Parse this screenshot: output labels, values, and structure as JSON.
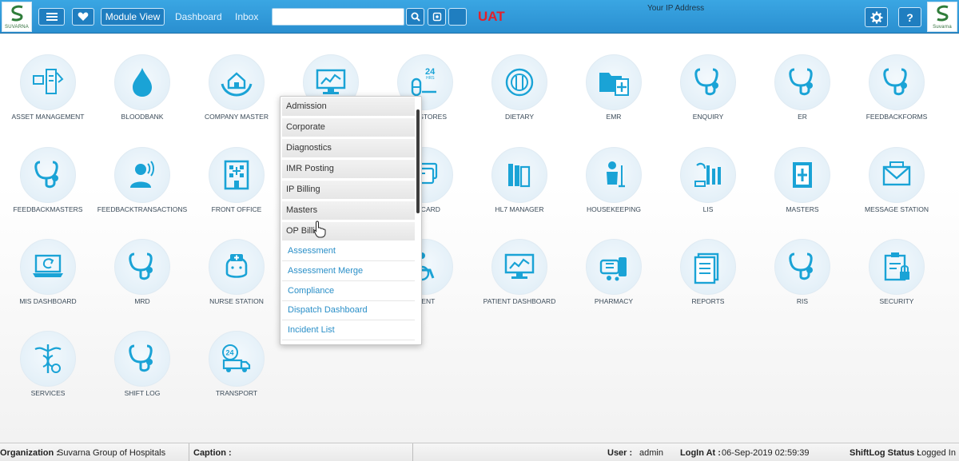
{
  "header": {
    "left_logo_text": "SUVARNA",
    "right_logo_text": "Suvarna",
    "menu_icon": "hamburger-icon",
    "favorites_icon": "heart-icon",
    "module_view_label": "Module View",
    "dashboard_link": "Dashboard",
    "inbox_link": "Inbox",
    "search": {
      "value": "",
      "placeholder": ""
    },
    "env_label": "UAT",
    "ip_label": "Your IP Address",
    "settings_icon": "gear-icon",
    "help_label": "?"
  },
  "modules": [
    {
      "label": "ASSET MANAGEMENT",
      "icon": "asset-icon"
    },
    {
      "label": "BLOODBANK",
      "icon": "blood-drop-icon"
    },
    {
      "label": "COMPANY MASTER",
      "icon": "home-hands-icon"
    },
    {
      "label": "",
      "icon": "monitor-chart-icon"
    },
    {
      "label": "ENT STORES",
      "icon": "pill-24hrs-icon",
      "badge": "24",
      "badge_sub": "HRS"
    },
    {
      "label": "DIETARY",
      "icon": "plate-cutlery-icon"
    },
    {
      "label": "EMR",
      "icon": "folder-plus-icon"
    },
    {
      "label": "ENQUIRY",
      "icon": "stethoscope-icon"
    },
    {
      "label": "ER",
      "icon": "stethoscope-icon"
    },
    {
      "label": "FEEDBACKFORMS",
      "icon": "stethoscope-icon"
    },
    {
      "label": "FEEDBACKMASTERS",
      "icon": "stethoscope-icon"
    },
    {
      "label": "FEEDBACKTRANSACTIONS",
      "icon": "speaking-person-icon"
    },
    {
      "label": "FRONT OFFICE",
      "icon": "hospital-building-icon"
    },
    {
      "label": "",
      "icon": "blank-icon"
    },
    {
      "label": "TH CARD",
      "icon": "cards-icon"
    },
    {
      "label": "HL7 MANAGER",
      "icon": "books-icon"
    },
    {
      "label": "HOUSEKEEPING",
      "icon": "housekeeper-icon"
    },
    {
      "label": "LIS",
      "icon": "lab-icon"
    },
    {
      "label": "MASTERS",
      "icon": "book-plus-icon"
    },
    {
      "label": "MESSAGE STATION",
      "icon": "envelope-icon"
    },
    {
      "label": "MIS DASHBOARD",
      "icon": "laptop-refresh-icon"
    },
    {
      "label": "MRD",
      "icon": "stethoscope-icon"
    },
    {
      "label": "NURSE STATION",
      "icon": "nurse-icon"
    },
    {
      "label": "",
      "icon": "blank-icon"
    },
    {
      "label": "TIENT",
      "icon": "wheelchair-icon"
    },
    {
      "label": "PATIENT DASHBOARD",
      "icon": "monitor-chart-icon"
    },
    {
      "label": "PHARMACY",
      "icon": "pills-bottle-icon"
    },
    {
      "label": "REPORTS",
      "icon": "document-icon"
    },
    {
      "label": "RIS",
      "icon": "stethoscope-icon"
    },
    {
      "label": "SECURITY",
      "icon": "clipboard-lock-icon"
    },
    {
      "label": "SERVICES",
      "icon": "caduceus-icon"
    },
    {
      "label": "SHIFT LOG",
      "icon": "stethoscope-icon"
    },
    {
      "label": "TRANSPORT",
      "icon": "ambulance-24-icon",
      "badge": "24"
    }
  ],
  "dropdown": {
    "items": [
      {
        "label": "Admission",
        "style": "grey"
      },
      {
        "label": "Corporate",
        "style": "grey"
      },
      {
        "label": "Diagnostics",
        "style": "grey"
      },
      {
        "label": "IMR Posting",
        "style": "grey"
      },
      {
        "label": "IP Billing",
        "style": "grey"
      },
      {
        "label": "Masters",
        "style": "grey"
      },
      {
        "label": "OP Billi",
        "style": "grey"
      },
      {
        "label": "Assessment",
        "style": "link"
      },
      {
        "label": "Assessment Merge",
        "style": "link"
      },
      {
        "label": "Compliance",
        "style": "link"
      },
      {
        "label": "Dispatch Dashboard",
        "style": "link"
      },
      {
        "label": "Incident List",
        "style": "link"
      }
    ]
  },
  "footer": {
    "org_label": "Organization :",
    "org_value": "Suvarna Group of Hospitals",
    "caption_label": "Caption :",
    "caption_value": "",
    "user_label": "User :",
    "user_value": "admin",
    "login_label": "LogIn At :",
    "login_value": "06-Sep-2019 02:59:39",
    "shift_label": "ShiftLog Status :",
    "shift_value": "Logged In"
  },
  "colors": {
    "topbar": "#2f9ad9",
    "accent": "#1aa3d6",
    "env_red": "#e3202a",
    "link": "#2a8fc8"
  }
}
